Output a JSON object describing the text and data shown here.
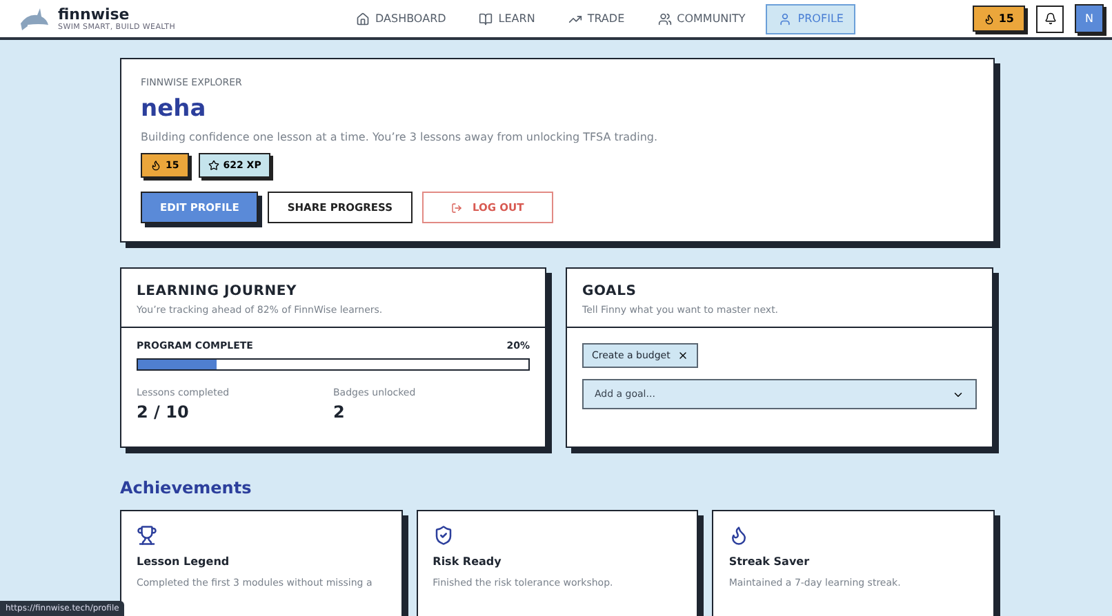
{
  "brand": {
    "name": "finnwise",
    "tagline": "SWIM SMART, BUILD WEALTH"
  },
  "nav": [
    {
      "label": "DASHBOARD",
      "kind": "home",
      "selected": false
    },
    {
      "label": "LEARN",
      "kind": "book",
      "selected": false
    },
    {
      "label": "TRADE",
      "kind": "trend",
      "selected": false
    },
    {
      "label": "COMMUNITY",
      "kind": "users",
      "selected": false
    },
    {
      "label": "PROFILE",
      "kind": "user",
      "selected": true
    }
  ],
  "header_streak": "15",
  "avatar": "N",
  "profile": {
    "eyebrow": "FINNWISE EXPLORER",
    "name": "neha",
    "bio": "Building confidence one lesson at a time. You’re 3 lessons away from unlocking TFSA trading.",
    "badges": [
      {
        "kind": "streak",
        "label": "15"
      },
      {
        "kind": "xp",
        "label": "622 XP"
      }
    ],
    "buttons": [
      {
        "kind": "primary",
        "label": "EDIT PROFILE"
      },
      {
        "kind": "outline",
        "label": "SHARE PROGRESS"
      },
      {
        "kind": "danger",
        "label": "LOG OUT"
      }
    ]
  },
  "journey": {
    "title": "LEARNING JOURNEY",
    "subtitle": "You’re tracking ahead of 82% of FinnWise learners.",
    "progress_label": "PROGRAM COMPLETE",
    "progress_reading": "20%",
    "level": 0.2,
    "stats": [
      {
        "label": "Lessons completed",
        "value": "2 / 10"
      },
      {
        "label": "Badges unlocked",
        "value": "2"
      }
    ]
  },
  "goals": {
    "title": "GOALS",
    "subtitle": "Tell Finny what you want to master next.",
    "chips": [
      "Create a budget"
    ],
    "select": {
      "placeholder": "Add a goal..."
    }
  },
  "achievements": {
    "title": "Achievements",
    "items": [
      {
        "kind": "trophy",
        "title": "Lesson Legend",
        "description": "Completed the first 3 modules without missing a"
      },
      {
        "kind": "shield",
        "title": "Risk Ready",
        "description": "Finished the risk tolerance workshop."
      },
      {
        "kind": "flame",
        "title": "Streak Saver",
        "description": "Maintained a 7-day learning streak."
      }
    ]
  },
  "status_link": "https://finnwise.tech/profile"
}
